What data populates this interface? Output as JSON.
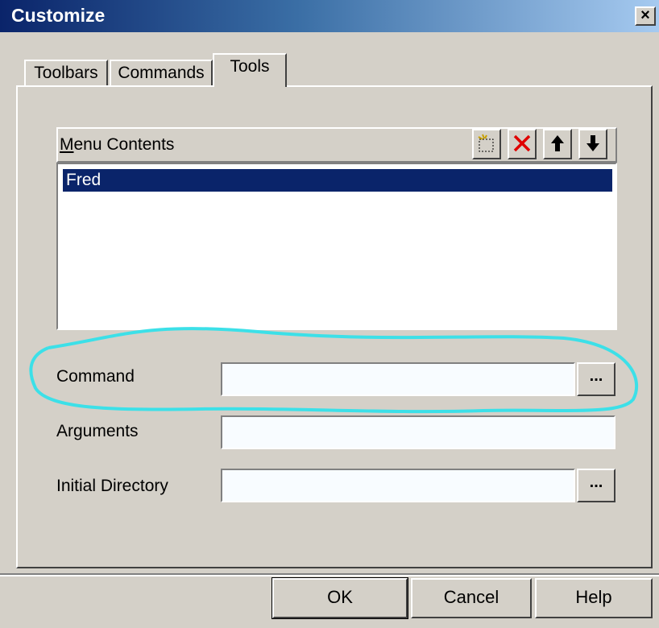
{
  "window": {
    "title": "Customize",
    "close_label": "×"
  },
  "tabs": [
    {
      "label": "Toolbars"
    },
    {
      "label": "Commands"
    },
    {
      "label": "Tools"
    }
  ],
  "menu": {
    "label_first": "M",
    "label_rest": "enu Contents",
    "items": [
      "Fred"
    ],
    "selected_index": 0,
    "toolbar_icons": [
      "new-icon",
      "delete-icon",
      "move-up-icon",
      "move-down-icon"
    ]
  },
  "fields": {
    "command": {
      "label": "Command",
      "value": ""
    },
    "arguments": {
      "label": "Arguments",
      "value": ""
    },
    "initial_directory": {
      "label": "Initial Directory",
      "value": ""
    },
    "browse_label": "..."
  },
  "buttons": {
    "ok": "OK",
    "cancel": "Cancel",
    "help": "Help"
  },
  "highlight_color": "#3ce0e8",
  "colors": {
    "selection": "#0a246a",
    "dialog_bg": "#d4d0c8"
  }
}
